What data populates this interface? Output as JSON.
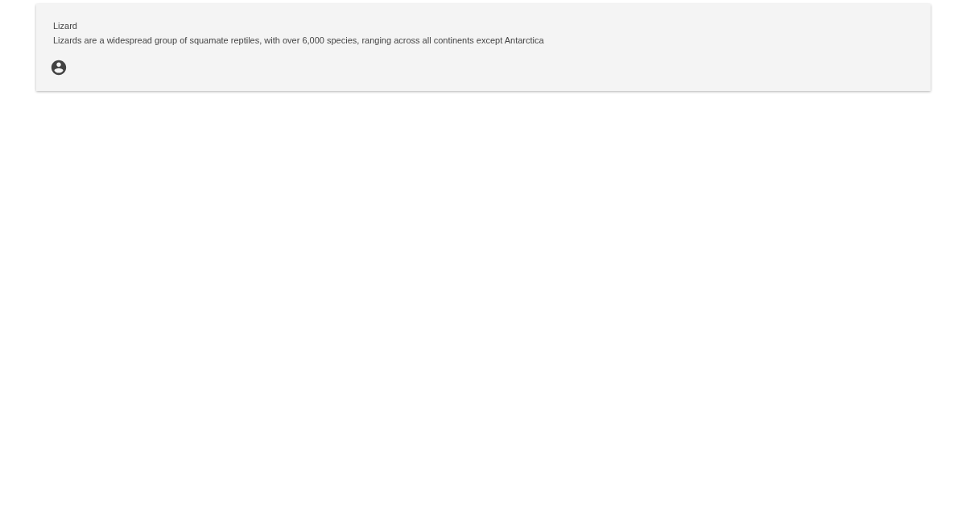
{
  "card": {
    "title": "Lizard",
    "text": "Lizards are a widespread group of squamate reptiles, with over 6,000 species, ranging across all continents except Antarctica"
  }
}
